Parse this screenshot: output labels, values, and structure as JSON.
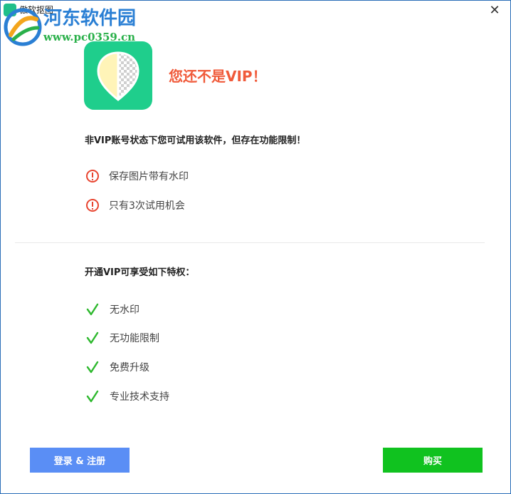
{
  "window": {
    "title": "傲软抠图",
    "close_glyph": "✕"
  },
  "watermark": {
    "site_name": "河东软件园",
    "site_url": "www.pc0359.cn"
  },
  "header": {
    "app_logo_icon": "leaf-half-transparent-icon",
    "headline": "您还不是VIP！",
    "headline_color": "#f05a3a"
  },
  "limits": {
    "notice": "非VIP账号状态下您可试用该软件，但存在功能限制！",
    "items": [
      {
        "icon": "warning-icon",
        "label": "保存图片带有水印"
      },
      {
        "icon": "warning-icon",
        "label": "只有3次试用机会"
      }
    ]
  },
  "privileges": {
    "title": "开通VIP可享受如下特权：",
    "items": [
      {
        "icon": "check-icon",
        "label": "无水印"
      },
      {
        "icon": "check-icon",
        "label": "无功能限制"
      },
      {
        "icon": "check-icon",
        "label": "免费升级"
      },
      {
        "icon": "check-icon",
        "label": "专业技术支持"
      }
    ]
  },
  "actions": {
    "login_label": "登录 & 注册",
    "buy_label": "购买",
    "login_color": "#5a8ef5",
    "buy_color": "#10c21f"
  }
}
